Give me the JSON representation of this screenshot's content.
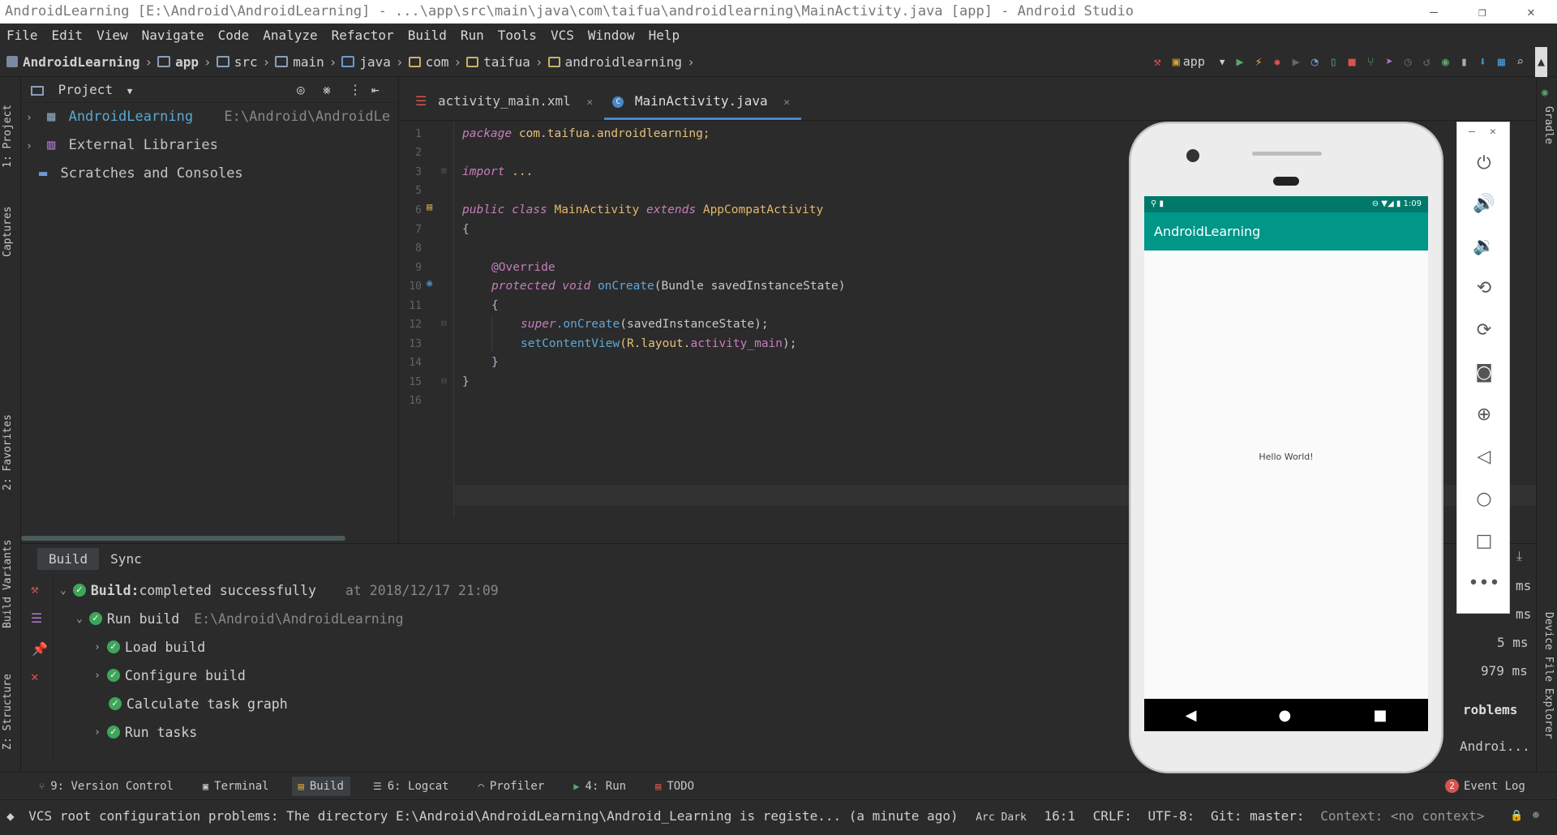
{
  "window": {
    "title": "AndroidLearning [E:\\Android\\AndroidLearning] - ...\\app\\src\\main\\java\\com\\taifua\\androidlearning\\MainActivity.java [app] - Android Studio",
    "minimize": "—",
    "maximize": "❐",
    "close": "✕"
  },
  "menu": [
    "File",
    "Edit",
    "View",
    "Navigate",
    "Code",
    "Analyze",
    "Refactor",
    "Build",
    "Run",
    "Tools",
    "VCS",
    "Window",
    "Help"
  ],
  "breadcrumb": [
    "AndroidLearning",
    "app",
    "src",
    "main",
    "java",
    "com",
    "taifua",
    "androidlearning"
  ],
  "toolbar": {
    "config": "app"
  },
  "left_tabs": {
    "project": "1: Project",
    "captures": "Captures",
    "favorites": "2: Favorites",
    "build_variants": "Build Variants",
    "structure": "Z: Structure"
  },
  "right_tabs": {
    "gradle": "Gradle",
    "device_explorer": "Device File Explorer"
  },
  "project_panel": {
    "title": "Project",
    "items": [
      {
        "label": "AndroidLearning",
        "path": "E:\\Android\\AndroidLe"
      },
      {
        "label": "External Libraries"
      },
      {
        "label": "Scratches and Consoles"
      }
    ]
  },
  "editor": {
    "tabs": [
      "activity_main.xml",
      "MainActivity.java"
    ],
    "active_tab": "MainActivity.java",
    "line_numbers": [
      "1",
      "2",
      "3",
      "5",
      "6",
      "7",
      "8",
      "9",
      "10",
      "11",
      "12",
      "13",
      "14",
      "15",
      "16"
    ],
    "code": {
      "l1_kw": "package",
      "l1_rest": " com.taifua.androidlearning;",
      "l3_kw": "import",
      "l3_rest": " ...",
      "l6_kw1": "public class",
      "l6_cls": " MainActivity",
      "l6_kw2": " extends",
      "l6_cls2": " AppCompatActivity",
      "l7": "{",
      "l9": "@Override",
      "l10_kw": "protected void",
      "l10_fn": " onCreate",
      "l10_rest": "(Bundle savedInstanceState)",
      "l11": "{",
      "l12_kw": "super",
      "l12_fn": ".onCreate",
      "l12_rest": "(savedInstanceState);",
      "l13_fn": "setContentView",
      "l13_rest": "(R.layout.",
      "l13_fld": "activity_main",
      "l13_end": ");",
      "l14": "}",
      "l15": "}"
    }
  },
  "build": {
    "tabs": [
      "Build",
      "Sync"
    ],
    "rows": [
      {
        "label_bold": "Build:",
        "label": " completed successfully",
        "extra": "at 2018/12/17 21:09"
      },
      {
        "label": "Run build",
        "extra": "E:\\Android\\AndroidLearning"
      },
      {
        "label": "Load build"
      },
      {
        "label": "Configure build"
      },
      {
        "label": "Calculate task graph"
      },
      {
        "label": "Run tasks"
      }
    ],
    "times": [
      "ms",
      "ms",
      "5 ms",
      "979 ms"
    ],
    "cut_texts": [
      "roblems",
      "Androi..."
    ]
  },
  "tool_windows": [
    "9: Version Control",
    "Terminal",
    "Build",
    "6: Logcat",
    "Profiler",
    "4: Run",
    "TODO"
  ],
  "event_log": {
    "count": "2",
    "label": "Event Log"
  },
  "status": {
    "message": "VCS root configuration problems: The directory E:\\Android\\AndroidLearning\\Android_Learning is registe... (a minute ago)",
    "theme": "Arc Dark",
    "position": "16:1",
    "line_sep": "CRLF",
    "encoding": "UTF-8",
    "git": "Git: master",
    "context": "Context: <no context>"
  },
  "emulator": {
    "status_time": "1:09",
    "app_title": "AndroidLearning",
    "hello": "Hello World!"
  }
}
